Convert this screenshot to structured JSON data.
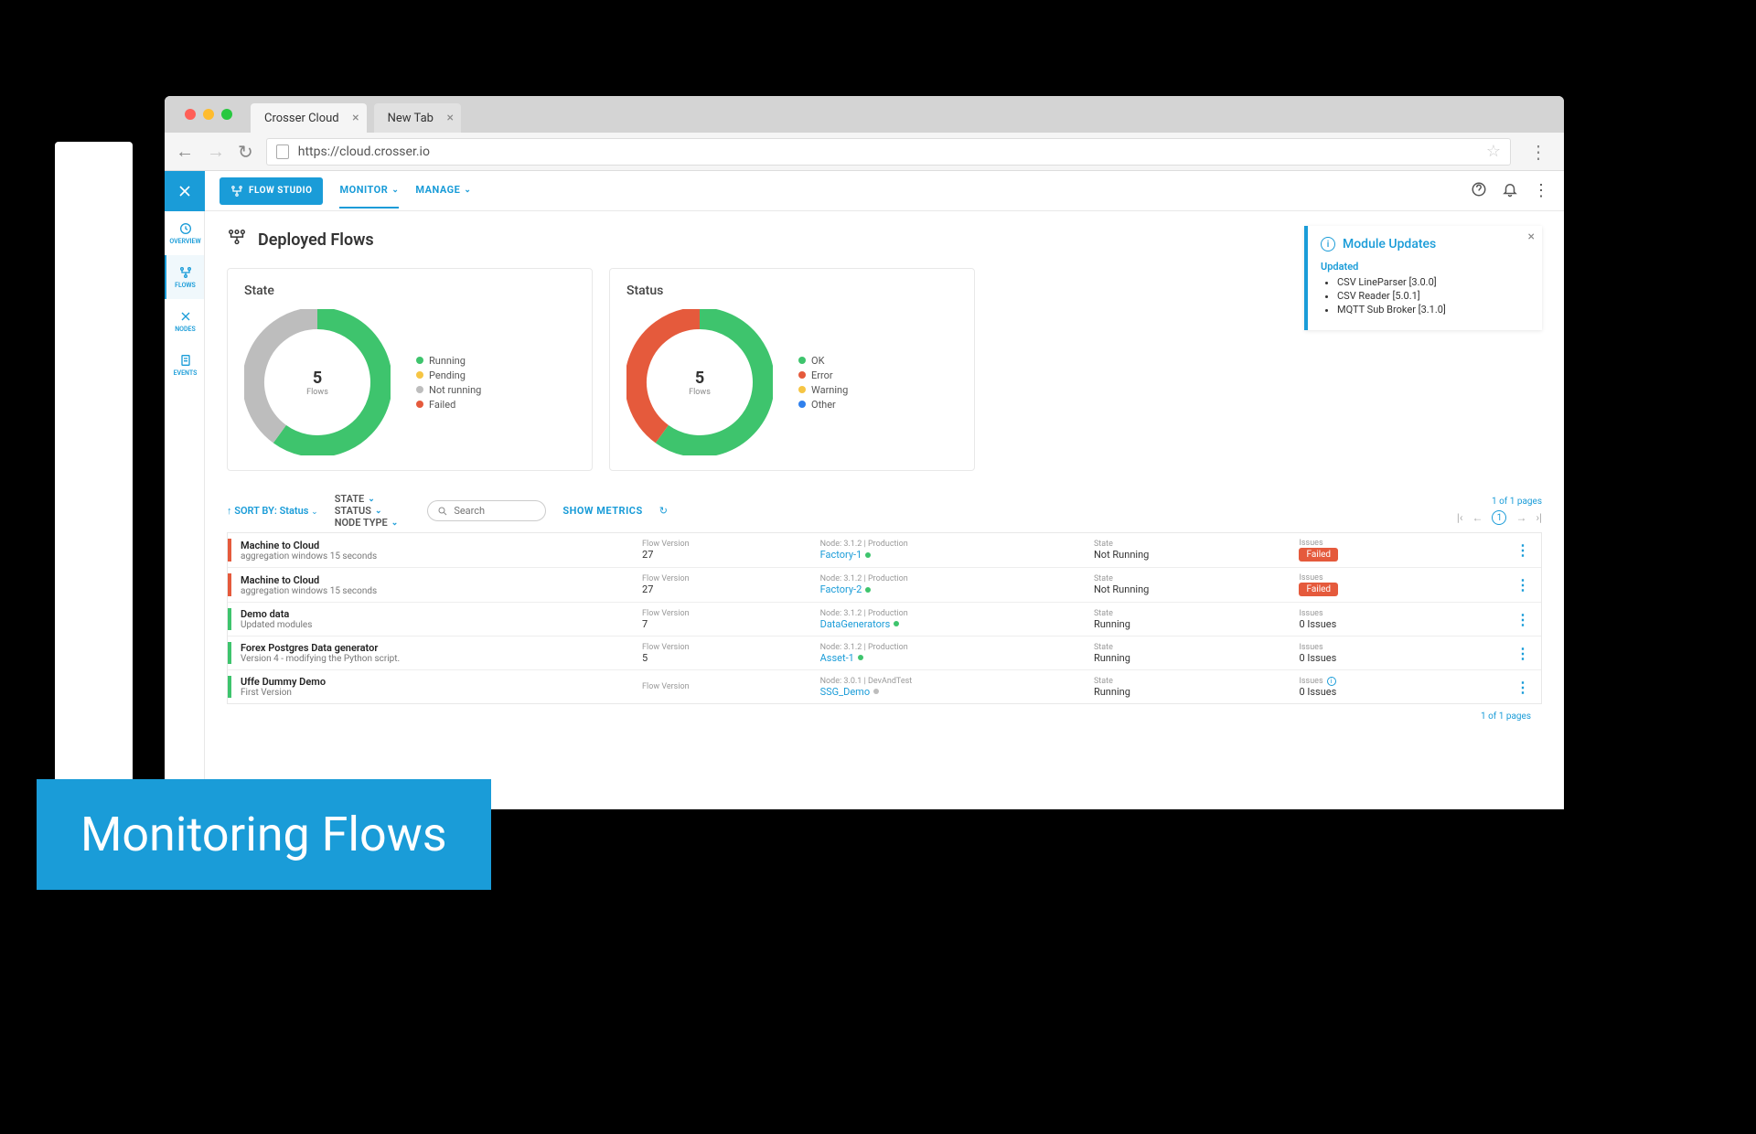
{
  "browser": {
    "tab1": "Crosser Cloud",
    "tab2": "New Tab",
    "url": "https://cloud.crosser.io"
  },
  "topnav": {
    "flow_studio": "FLOW STUDIO",
    "monitor": "MONITOR",
    "manage": "MANAGE"
  },
  "sidebar": {
    "items": [
      {
        "label": "OVERVIEW"
      },
      {
        "label": "FLOWS"
      },
      {
        "label": "NODES"
      },
      {
        "label": "EVENTS"
      }
    ]
  },
  "page": {
    "title": "Deployed Flows"
  },
  "info_panel": {
    "title": "Module Updates",
    "sub": "Updated",
    "items": [
      "CSV LineParser [3.0.0]",
      "CSV Reader [5.0.1]",
      "MQTT Sub Broker [3.1.0]"
    ]
  },
  "chart_data": [
    {
      "type": "pie",
      "title": "State",
      "center_value": "5",
      "center_label": "Flows",
      "series": [
        {
          "name": "Running",
          "value": 3,
          "color": "#3ec46d"
        },
        {
          "name": "Pending",
          "value": 0,
          "color": "#f6c544"
        },
        {
          "name": "Not running",
          "value": 2,
          "color": "#bdbdbd"
        },
        {
          "name": "Failed",
          "value": 0,
          "color": "#e55a3c"
        }
      ]
    },
    {
      "type": "pie",
      "title": "Status",
      "center_value": "5",
      "center_label": "Flows",
      "series": [
        {
          "name": "OK",
          "value": 3,
          "color": "#3ec46d"
        },
        {
          "name": "Error",
          "value": 2,
          "color": "#e55a3c"
        },
        {
          "name": "Warning",
          "value": 0,
          "color": "#f6c544"
        },
        {
          "name": "Other",
          "value": 0,
          "color": "#2f80ed"
        }
      ]
    }
  ],
  "toolbar": {
    "sort_prefix": "↑ SORT BY:",
    "sort_value": "Status",
    "filters": [
      "STATE",
      "STATUS",
      "NODE TYPE"
    ],
    "search_placeholder": "Search",
    "show_metrics": "SHOW METRICS",
    "page_text": "1 of 1 pages",
    "current_page": "1"
  },
  "table": {
    "col_labels": {
      "flow_version": "Flow Version",
      "node": "Node:",
      "state": "State",
      "issues": "Issues"
    },
    "rows": [
      {
        "bar": "#e55a3c",
        "name": "Machine to Cloud",
        "sub": "aggregation windows 15 seconds",
        "version": "27",
        "node_meta": "3.1.2 | Production",
        "node": "Factory-1",
        "dot": "#3ec46d",
        "state": "Not Running",
        "issues_badge": "Failed"
      },
      {
        "bar": "#e55a3c",
        "name": "Machine to Cloud",
        "sub": "aggregation windows 15 seconds",
        "version": "27",
        "node_meta": "3.1.2 | Production",
        "node": "Factory-2",
        "dot": "#3ec46d",
        "state": "Not Running",
        "issues_badge": "Failed"
      },
      {
        "bar": "#3ec46d",
        "name": "Demo data",
        "sub": "Updated modules",
        "version": "7",
        "node_meta": "3.1.2 | Production",
        "node": "DataGenerators",
        "dot": "#3ec46d",
        "state": "Running",
        "issues": "0 Issues"
      },
      {
        "bar": "#3ec46d",
        "name": "Forex Postgres Data generator",
        "sub": "Version 4 - modifying the Python script.",
        "version": "5",
        "node_meta": "3.1.2 | Production",
        "node": "Asset-1",
        "dot": "#3ec46d",
        "state": "Running",
        "issues": "0 Issues"
      },
      {
        "bar": "#3ec46d",
        "name": "Uffe Dummy Demo",
        "sub": "First Version",
        "version": "",
        "node_meta": "3.0.1 | DevAndTest",
        "node": "SSG_Demo",
        "dot": "#bdbdbd",
        "state": "Running",
        "issues": "0 Issues",
        "issues_info": true
      }
    ]
  },
  "overlay": {
    "text": "Monitoring Flows"
  },
  "colors": {
    "brand": "#1a9cd8",
    "green": "#3ec46d",
    "orange": "#e55a3c",
    "yellow": "#f6c544",
    "blue": "#2f80ed",
    "grey": "#bdbdbd"
  }
}
